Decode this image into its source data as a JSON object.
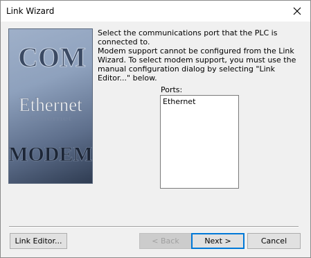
{
  "window": {
    "title": "Link Wizard"
  },
  "icons": {
    "close": "close-icon"
  },
  "banner": {
    "line1": "COM",
    "line2": "Ethernet",
    "line3": "MODEM"
  },
  "content": {
    "instruction": "Select the communications port that the PLC is connected to.",
    "modem_note": "Modem support cannot be configured from the Link Wizard. To select modem support, you must use the manual configuration dialog by selecting \"Link Editor...\" below.",
    "ports_label": "Ports:",
    "ports": [
      "Ethernet"
    ]
  },
  "buttons": {
    "link_editor": "Link Editor...",
    "back": "< Back",
    "next": "Next >",
    "cancel": "Cancel"
  },
  "state": {
    "back_enabled": false,
    "default_button": "Next >"
  }
}
